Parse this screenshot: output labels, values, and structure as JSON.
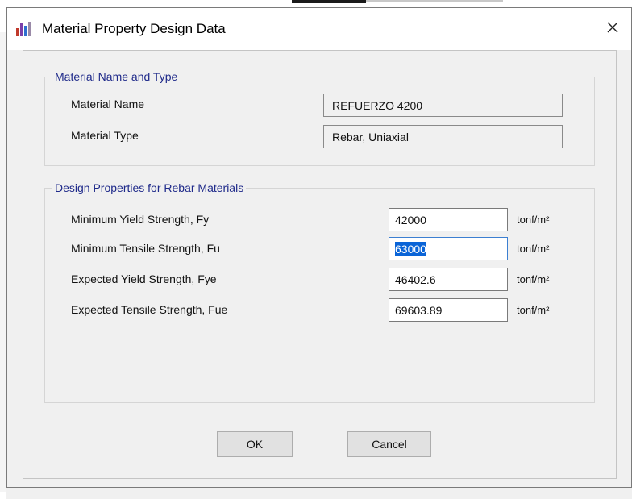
{
  "window": {
    "title": "Material Property Design Data",
    "close_glyph": "×",
    "app_icon": "chart-bars-icon"
  },
  "name_group": {
    "legend": "Material Name and Type",
    "name_label": "Material Name",
    "name_value": "REFUERZO 4200",
    "type_label": "Material Type",
    "type_value": "Rebar, Uniaxial"
  },
  "design_group": {
    "legend": "Design Properties for Rebar Materials",
    "rows": [
      {
        "label": "Minimum Yield Strength, Fy",
        "value": "42000",
        "unit": "tonf/m²",
        "selected": false
      },
      {
        "label": "Minimum Tensile Strength, Fu",
        "value": "63000",
        "unit": "tonf/m²",
        "selected": true
      },
      {
        "label": "Expected Yield Strength, Fye",
        "value": "46402.6",
        "unit": "tonf/m²",
        "selected": false
      },
      {
        "label": "Expected Tensile Strength, Fue",
        "value": "69603.89",
        "unit": "tonf/m²",
        "selected": false
      }
    ]
  },
  "buttons": {
    "ok": "OK",
    "cancel": "Cancel"
  },
  "colors": {
    "legend_text": "#1f2a8a",
    "selection": "#0a64d7",
    "dialog_bg": "#f0f0f0"
  }
}
